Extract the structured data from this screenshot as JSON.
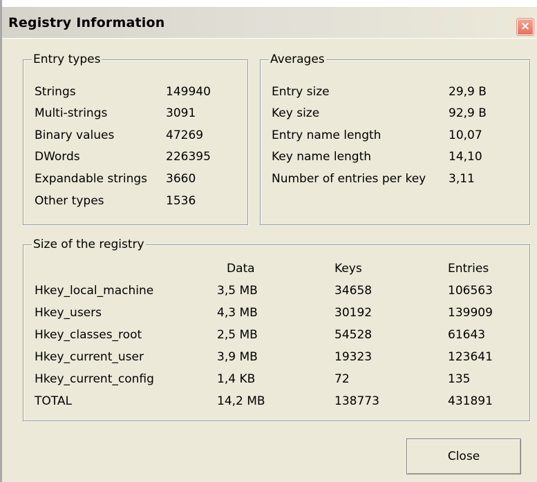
{
  "dialog": {
    "title": "Registry Information",
    "close_icon_glyph": "×",
    "close_button_label": "Close"
  },
  "entry_types": {
    "title": "Entry types",
    "rows": [
      {
        "label": "Strings",
        "value": "149940"
      },
      {
        "label": "Multi-strings",
        "value": "3091"
      },
      {
        "label": "Binary values",
        "value": "47269"
      },
      {
        "label": "DWords",
        "value": "226395"
      },
      {
        "label": "Expandable strings",
        "value": "3660"
      },
      {
        "label": "Other types",
        "value": "1536"
      }
    ]
  },
  "averages": {
    "title": "Averages",
    "rows": [
      {
        "label": "Entry size",
        "value": "29,9 B"
      },
      {
        "label": "Key size",
        "value": "92,9 B"
      },
      {
        "label": "Entry name length",
        "value": "10,07"
      },
      {
        "label": "Key name length",
        "value": "14,10"
      },
      {
        "label": "Number of entries per key",
        "value": "3,11"
      }
    ]
  },
  "size": {
    "title": "Size of the registry",
    "columns": [
      "Data",
      "Keys",
      "Entries"
    ],
    "rows": [
      {
        "name": "Hkey_local_machine",
        "data": "3,5 MB",
        "keys": "34658",
        "entries": "106563"
      },
      {
        "name": "Hkey_users",
        "data": "4,3 MB",
        "keys": "30192",
        "entries": "139909"
      },
      {
        "name": "Hkey_classes_root",
        "data": "2,5 MB",
        "keys": "54528",
        "entries": "61643"
      },
      {
        "name": "Hkey_current_user",
        "data": "3,9 MB",
        "keys": "19323",
        "entries": "123641"
      },
      {
        "name": "Hkey_current_config",
        "data": "1,4 KB",
        "keys": "72",
        "entries": "135"
      },
      {
        "name": "TOTAL",
        "data": "14,2 MB",
        "keys": "138773",
        "entries": "431891"
      }
    ]
  },
  "colors": {
    "dialog_bg": "#ece9d8",
    "close_icon_bg": "#e3735f"
  }
}
